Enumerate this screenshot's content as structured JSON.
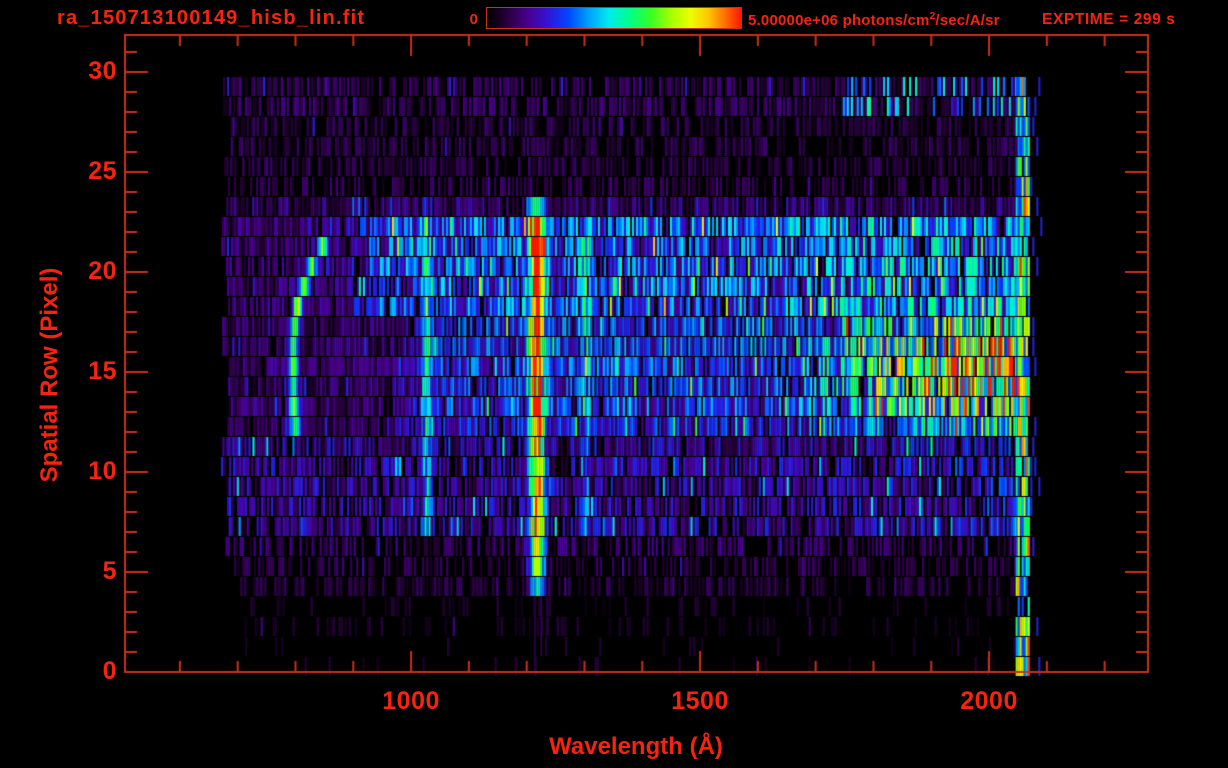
{
  "window": {
    "background": "#000000"
  },
  "colors": {
    "text_red": "#f5230f",
    "axis_red": "#c9301b",
    "background": "#000000"
  },
  "header": {
    "title": "ra_150713100149_hisb_lin.fit",
    "colorbar_min_label": "0",
    "colorbar_max_prefix": "5.00000e+06 photons/cm",
    "colorbar_max_sup": "2",
    "colorbar_max_suffix": "/sec/A/sr",
    "exptime_label": "EXPTIME = 299 s"
  },
  "axis": {
    "x_title": "Wavelength (Å)",
    "y_title": "Spatial Row (Pixel)",
    "x_tick_labels": [
      "1000",
      "1500",
      "2000"
    ],
    "y_tick_labels": [
      "0",
      "5",
      "10",
      "15",
      "20",
      "25",
      "30"
    ]
  },
  "chart_data": {
    "type": "heatmap",
    "subtype": "2d-spectral-image",
    "title": "ra_150713100149_hisb_lin.fit",
    "xlabel": "Wavelength (Å)",
    "ylabel": "Spatial Row (Pixel)",
    "x_range": [
      505,
      2275
    ],
    "y_range": [
      0,
      31.85
    ],
    "x_ticks": [
      1000,
      1500,
      2000
    ],
    "x_minor_step": 100,
    "y_ticks": [
      0,
      5,
      10,
      15,
      20,
      25,
      30
    ],
    "y_minor_step": 1,
    "grid": false,
    "colorbar": {
      "min": 0,
      "max": 5000000,
      "min_label": "0",
      "max_label": "5.00000e+06",
      "units": "photons/cm^2/sec/A/sr",
      "position": "top"
    },
    "exposure_time_s": 299,
    "data_extent": {
      "wavelength": [
        668,
        2068
      ],
      "rows": [
        1,
        30
      ]
    },
    "colormap": "rainbow",
    "colormap_stops": [
      [
        0.0,
        0,
        0,
        0
      ],
      [
        0.08,
        40,
        0,
        60
      ],
      [
        0.16,
        72,
        0,
        142
      ],
      [
        0.24,
        50,
        20,
        212
      ],
      [
        0.32,
        0,
        70,
        255
      ],
      [
        0.4,
        0,
        160,
        255
      ],
      [
        0.48,
        0,
        235,
        235
      ],
      [
        0.56,
        0,
        255,
        140
      ],
      [
        0.64,
        50,
        255,
        40
      ],
      [
        0.72,
        160,
        255,
        0
      ],
      [
        0.8,
        235,
        255,
        0
      ],
      [
        0.87,
        255,
        200,
        0
      ],
      [
        0.93,
        255,
        120,
        0
      ],
      [
        1.0,
        255,
        25,
        0
      ]
    ],
    "noise_seed": 20150713,
    "row_bands": [
      {
        "rows": [
          29,
          30
        ],
        "level": 0.1,
        "sparse": 0.4,
        "flecks": {
          "min_wavelength": 1740,
          "chance": 0.2,
          "level": [
            0.28,
            0.55
          ]
        }
      },
      {
        "rows": [
          25,
          28
        ],
        "level": 0.085,
        "sparse": 0.5
      },
      {
        "rows": [
          24,
          24
        ],
        "level": 0.13,
        "sparse": 0.25
      },
      {
        "rows": [
          19,
          23
        ],
        "sparse": 0.12,
        "profile": [
          [
            668,
            0.12
          ],
          [
            868,
            0.13
          ],
          [
            952,
            0.3
          ],
          [
            1600,
            0.31
          ],
          [
            1752,
            0.37
          ],
          [
            2068,
            0.38
          ]
        ]
      },
      {
        "rows": [
          14,
          18
        ],
        "sparse": 0.1,
        "profile": [
          [
            668,
            0.11
          ],
          [
            948,
            0.12
          ],
          [
            1052,
            0.26
          ],
          [
            1648,
            0.28
          ],
          [
            1900,
            0.56
          ],
          [
            2068,
            0.66
          ]
        ]
      },
      {
        "rows": [
          13,
          13
        ],
        "sparse": 0.15,
        "profile": [
          [
            668,
            0.1
          ],
          [
            950,
            0.11
          ],
          [
            1050,
            0.22
          ],
          [
            1650,
            0.24
          ],
          [
            1900,
            0.42
          ],
          [
            2068,
            0.5
          ]
        ]
      },
      {
        "rows": [
          8,
          12
        ],
        "sparse": 0.28,
        "profile": [
          [
            668,
            0.17
          ],
          [
            1700,
            0.18
          ],
          [
            2068,
            0.24
          ]
        ]
      },
      {
        "rows": [
          7,
          7
        ],
        "level": 0.11,
        "sparse": 0.5
      },
      {
        "rows": [
          5,
          6
        ],
        "level": 0.08,
        "sparse": 0.55
      },
      {
        "rows": [
          3,
          4
        ],
        "level": 0.055,
        "sparse": 0.8
      },
      {
        "rows": [
          1,
          2
        ],
        "level": 0.05,
        "sparse": 0.93
      }
    ],
    "hot_rows": {
      "rows": [
        15,
        17
      ],
      "min_wavelength": 1700,
      "factor": 1.18
    },
    "emission_lines": [
      {
        "name": "emission-line-1025",
        "wavelength": 1025,
        "sigma": 6,
        "rows": [
          8,
          24
        ],
        "amplitude": 0.33,
        "row_taper": {
          "24": 0.45
        }
      },
      {
        "name": "emission-line-1216-lyman-alpha",
        "wavelength": 1216,
        "sigma": 9,
        "rows": [
          5,
          24
        ],
        "amplitude": 0.8,
        "row_taper": {
          "5": 0.55,
          "6": 0.85,
          "24": 0.62
        }
      },
      {
        "name": "emission-line-1300",
        "wavelength": 1300,
        "sigma": 7,
        "rows": [
          8,
          23
        ],
        "amplitude": 0.22
      },
      {
        "name": "emission-line-1356",
        "wavelength": 1356,
        "sigma": 5,
        "rows": [
          9,
          20
        ],
        "amplitude": 0.13
      }
    ],
    "arc_feature": {
      "rows": [
        13,
        22
      ],
      "vertex_wavelength": 795,
      "vertex_row": 17,
      "curvature": 2.0,
      "lower_curvature": 0.15,
      "sigma": 6,
      "amplitude": 0.52
    },
    "edge_column": {
      "wavelength": [
        2046,
        2068
      ],
      "rows": [
        1,
        30
      ],
      "level": [
        0.3,
        1.0
      ],
      "sparse": 0.18,
      "stray": {
        "wavelength": [
          2068,
          2092
        ],
        "chance": 0.07,
        "level": 0.26
      }
    },
    "drip_lines": [
      {
        "wavelength": 1213,
        "rows": [
          0,
          4
        ],
        "level": 0.1
      },
      {
        "wavelength": 1224,
        "rows": [
          2,
          4
        ],
        "level": 0.11
      },
      {
        "wavelength": 1233,
        "rows": [
          3,
          4
        ],
        "level": 0.08
      },
      {
        "wavelength": 1597,
        "rows": [
          0,
          1
        ],
        "level": 0.12
      },
      {
        "wavelength": 1997,
        "rows": [
          0,
          1
        ],
        "level": 0.12
      }
    ]
  }
}
